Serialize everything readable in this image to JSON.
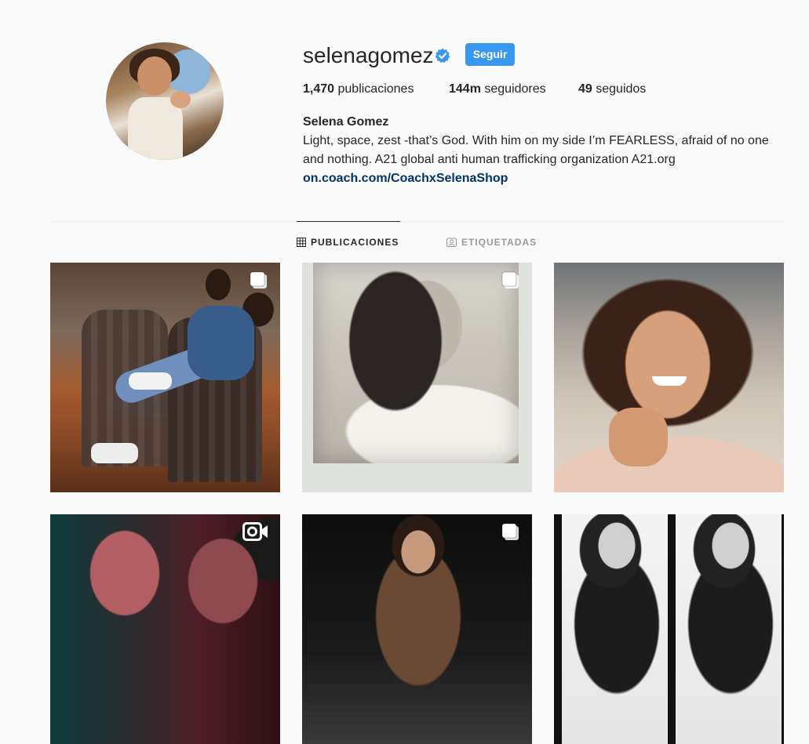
{
  "profile": {
    "username": "selenagomez",
    "follow_label": "Seguir",
    "stats": {
      "posts_count": "1,470",
      "posts_label": "publicaciones",
      "followers_count": "144m",
      "followers_label": "seguidores",
      "following_count": "49",
      "following_label": "seguidos"
    },
    "full_name": "Selena Gomez",
    "bio": "Light, space, zest -that’s God. With him on my side I’m FEARLESS, afraid of no one and nothing. A21 global anti human trafficking organization A21.org",
    "link": "on.coach.com/CoachxSelenaShop"
  },
  "tabs": [
    {
      "label": "PUBLICACIONES",
      "icon": "grid-icon",
      "active": true
    },
    {
      "label": "ETIQUETADAS",
      "icon": "tagged-user-icon",
      "active": false
    }
  ],
  "posts": [
    {
      "type": "carousel",
      "icon": "carousel-icon"
    },
    {
      "type": "carousel",
      "icon": "carousel-icon"
    },
    {
      "type": "photo"
    },
    {
      "type": "video",
      "icon": "video-icon"
    },
    {
      "type": "carousel",
      "icon": "carousel-icon"
    },
    {
      "type": "photo"
    }
  ],
  "colors": {
    "follow_button": "#3897f0",
    "verified_badge": "#3897f0",
    "link": "#003569",
    "background": "#fafafa"
  }
}
